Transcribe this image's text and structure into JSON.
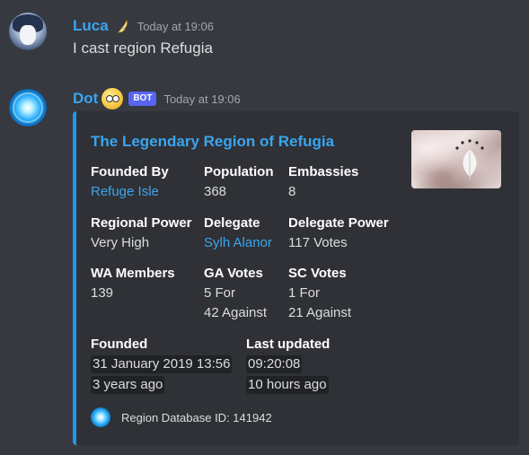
{
  "messages": [
    {
      "username": "Luca",
      "timestamp": "Today at 19:06",
      "text": "I cast region Refugia"
    },
    {
      "username": "Dot",
      "badge": "BOT",
      "timestamp": "Today at 19:06"
    }
  ],
  "embed": {
    "title": "The Legendary Region of Refugia",
    "accent_color": "#1e98ef",
    "fields": {
      "founded_by": {
        "name": "Founded By",
        "value": "Refuge Isle"
      },
      "population": {
        "name": "Population",
        "value": "368"
      },
      "embassies": {
        "name": "Embassies",
        "value": "8"
      },
      "regional_power": {
        "name": "Regional Power",
        "value": "Very High"
      },
      "delegate": {
        "name": "Delegate",
        "value": "Sylh Alanor"
      },
      "delegate_power": {
        "name": "Delegate Power",
        "value": "117 Votes"
      },
      "wa_members": {
        "name": "WA Members",
        "value": "139"
      },
      "ga_votes": {
        "name": "GA Votes",
        "line1": "5 For",
        "line2": "42 Against"
      },
      "sc_votes": {
        "name": "SC Votes",
        "line1": "1 For",
        "line2": "21 Against"
      },
      "founded": {
        "name": "Founded",
        "line1": "31 January 2019 13:56",
        "line2": "3 years ago"
      },
      "last_updated": {
        "name": "Last updated",
        "line1": "09:20:08",
        "line2": "10 hours ago"
      }
    },
    "footer": "Region Database ID: 141942"
  },
  "colors": {
    "background": "#36393f",
    "embed_background": "#2f3136",
    "link": "#3aa5ef",
    "bot_badge": "#5865f2"
  },
  "icons": {
    "luca_tag": "bird-icon",
    "dot_tag": "emoji-face-icon"
  }
}
